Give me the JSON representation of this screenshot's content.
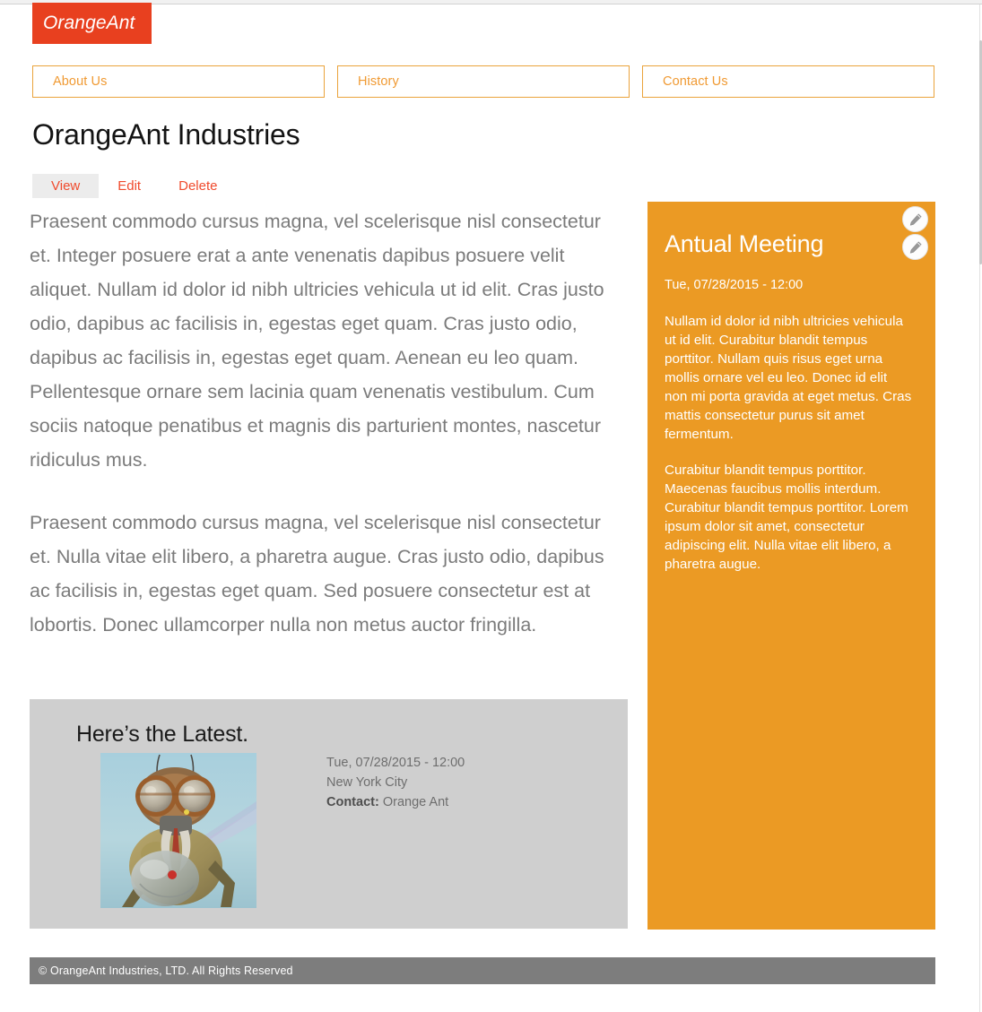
{
  "site": {
    "logo_text": "OrangeAnt",
    "logo_bg_color": "#e8401f",
    "accent_orange": "#eb9a24",
    "accent_red": "#f04b2d",
    "gray_block_color": "#cfcfcf",
    "footer_bg_color": "#7d7d7d"
  },
  "nav": {
    "items": [
      {
        "label": "About Us"
      },
      {
        "label": "History"
      },
      {
        "label": "Contact Us"
      }
    ]
  },
  "page": {
    "title": "OrangeAnt Industries"
  },
  "tabs": [
    {
      "label": "View",
      "active": true
    },
    {
      "label": "Edit",
      "active": false
    },
    {
      "label": "Delete",
      "active": false
    }
  ],
  "article": {
    "paragraphs": [
      "Praesent commodo cursus magna, vel scelerisque nisl consectetur et. Integer posuere erat a ante venenatis dapibus posuere velit aliquet. Nullam id dolor id nibh ultricies vehicula ut id elit. Cras justo odio, dapibus ac facilisis in, egestas eget quam. Cras justo odio, dapibus ac facilisis in, egestas eget quam. Aenean eu leo quam. Pellentesque ornare sem lacinia quam venenatis vestibulum. Cum sociis natoque penatibus et magnis dis parturient montes, nascetur ridiculus mus.",
      "Praesent commodo cursus magna, vel scelerisque nisl consectetur et. Nulla vitae elit libero, a pharetra augue. Cras justo odio, dapibus ac facilisis in, egestas eget quam. Sed posuere consectetur est at lobortis. Donec ullamcorper nulla non metus auctor fringilla."
    ]
  },
  "latest": {
    "title": "Here’s the Latest.",
    "image_alt": "ant-creature-photo",
    "date": "Tue, 07/28/2015 - 12:00",
    "location": "New York City",
    "contact_label": "Contact:",
    "contact_value": "Orange Ant"
  },
  "panel": {
    "title": "Antual Meeting",
    "date": "Tue, 07/28/2015 - 12:00",
    "paragraphs": [
      "Nullam id dolor id nibh ultricies vehicula ut id elit. Curabitur blandit tempus porttitor. Nullam quis risus eget urna mollis ornare vel eu leo. Donec id elit non mi porta gravida at eget metus. Cras mattis consectetur purus sit amet fermentum.",
      "Curabitur blandit tempus porttitor. Maecenas faucibus mollis interdum. Curabitur blandit tempus porttitor. Lorem ipsum dolor sit amet, consectetur adipiscing elit. Nulla vitae elit libero, a pharetra augue."
    ],
    "actions": [
      {
        "icon": "pencil-icon"
      },
      {
        "icon": "pencil-icon"
      }
    ]
  },
  "footer": {
    "text": "© OrangeAnt Industries, LTD. All Rights Reserved"
  }
}
